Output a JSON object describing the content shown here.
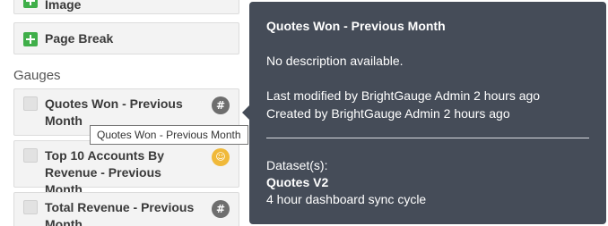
{
  "panel": {
    "widgets": [
      {
        "label": "Image"
      },
      {
        "label": "Page Break"
      }
    ],
    "gauges_title": "Gauges",
    "gauges": [
      {
        "label": "Quotes Won - Previous Month",
        "badge": "#",
        "badge_color": "#6e6e6e"
      },
      {
        "label": "Top 10 Accounts By Revenue - Previous Month",
        "badge": "☺",
        "badge_color": "#f0b93a"
      },
      {
        "label": "Total Revenue - Previous Month",
        "badge": "#",
        "badge_color": "#6e6e6e"
      }
    ]
  },
  "tooltip": {
    "text": "Quotes Won - Previous Month"
  },
  "popover": {
    "title": "Quotes Won - Previous Month",
    "description": "No description available.",
    "last_modified": "Last modified by BrightGauge Admin 2 hours ago",
    "created": "Created by BrightGauge Admin 2 hours ago",
    "dataset_label": "Dataset(s):",
    "dataset_name": "Quotes V2",
    "sync": "4 hour dashboard sync cycle",
    "background": "#454c58"
  },
  "colors": {
    "accent_green": "#3fae49"
  }
}
